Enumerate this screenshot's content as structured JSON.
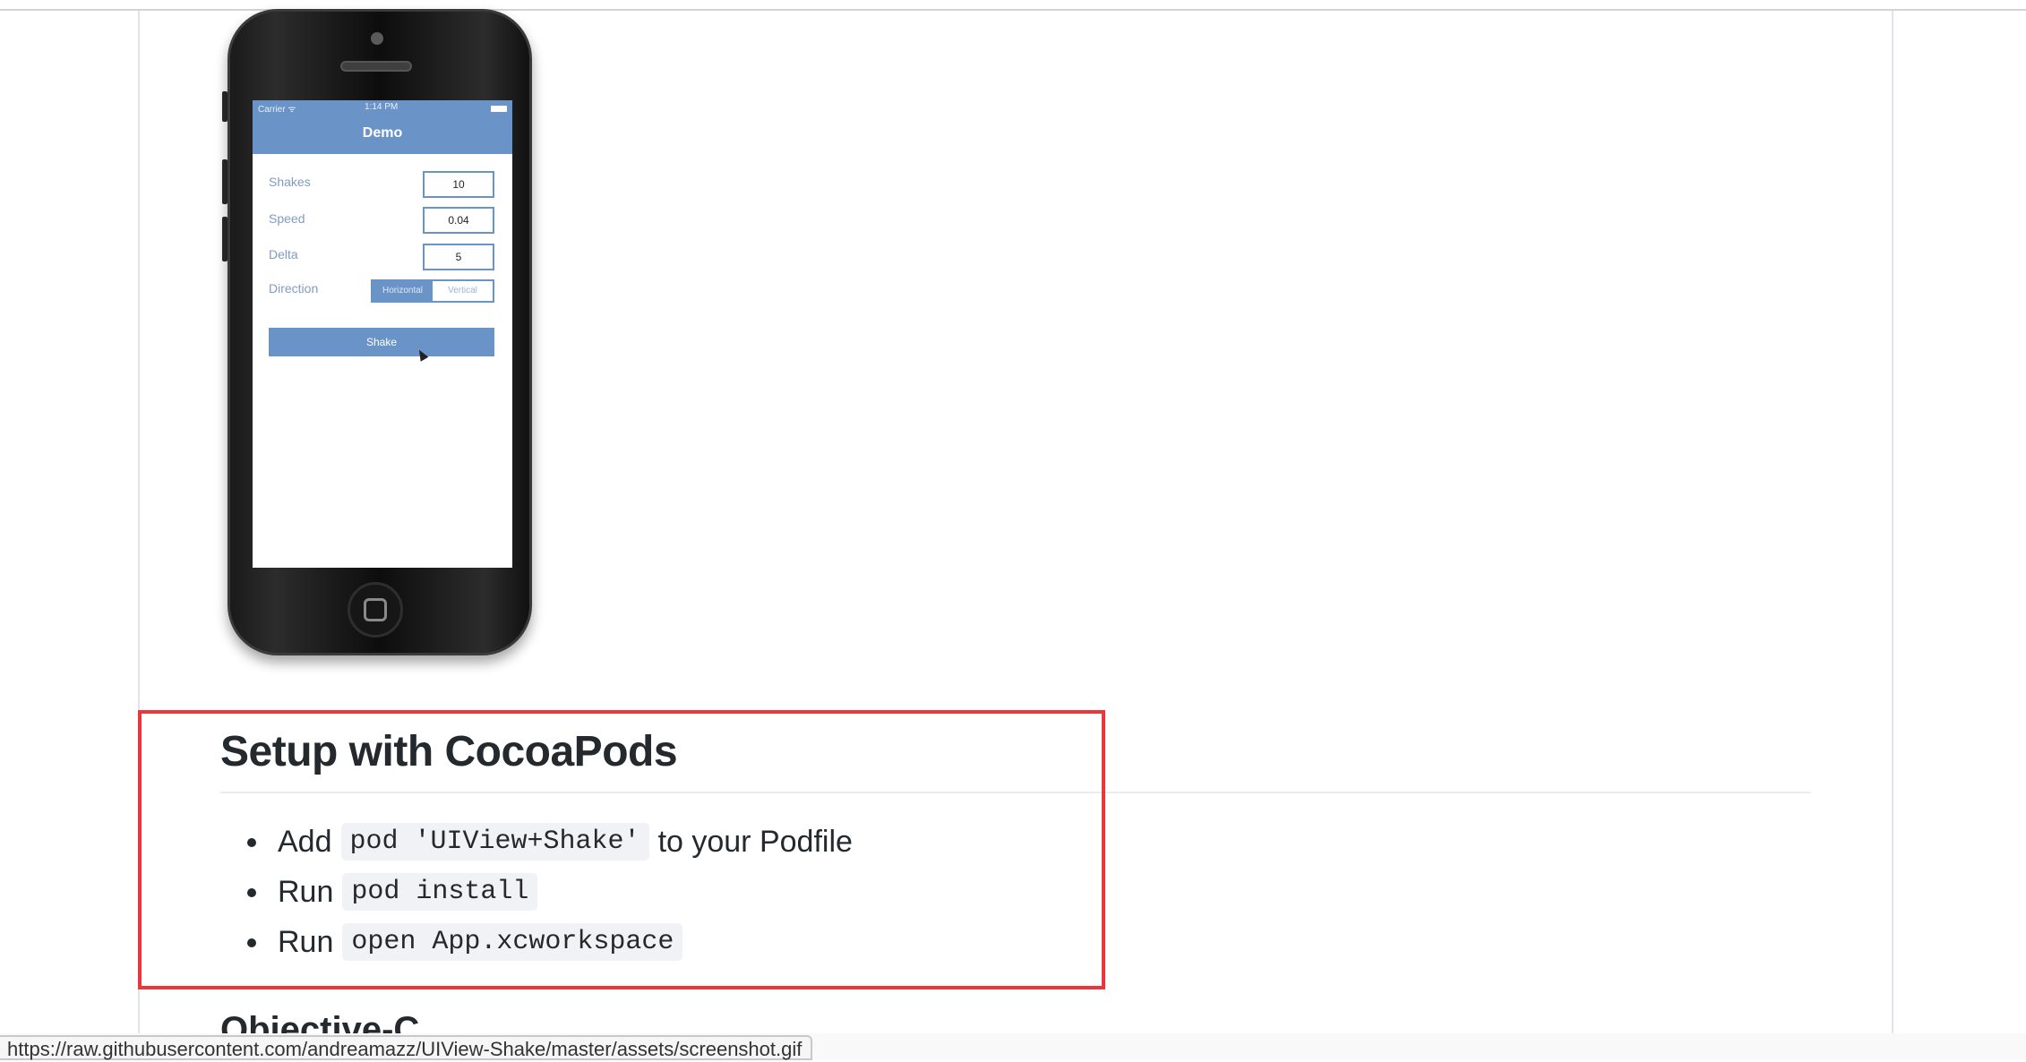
{
  "phone_screenshot": {
    "status_carrier": "Carrier ᯤ",
    "status_time": "1:14 PM",
    "nav_title": "Demo",
    "fields": [
      {
        "label": "Shakes",
        "value": "10"
      },
      {
        "label": "Speed",
        "value": "0.04"
      },
      {
        "label": "Delta",
        "value": "5"
      }
    ],
    "direction_label": "Direction",
    "direction_options": [
      "Horizontal",
      "Vertical"
    ],
    "direction_selected": "Horizontal",
    "shake_button": "Shake"
  },
  "readme": {
    "setup_heading": "Setup with CocoaPods",
    "steps": [
      {
        "prefix": "Add",
        "code": "pod 'UIView+Shake'",
        "suffix": "to your Podfile"
      },
      {
        "prefix": "Run",
        "code": "pod install",
        "suffix": ""
      },
      {
        "prefix": "Run",
        "code": "open App.xcworkspace",
        "suffix": ""
      }
    ],
    "next_heading": "Objective-C"
  },
  "highlight_color": "#e8383d",
  "status_bar_url": "https://raw.githubusercontent.com/andreamazz/UIView-Shake/master/assets/screenshot.gif"
}
